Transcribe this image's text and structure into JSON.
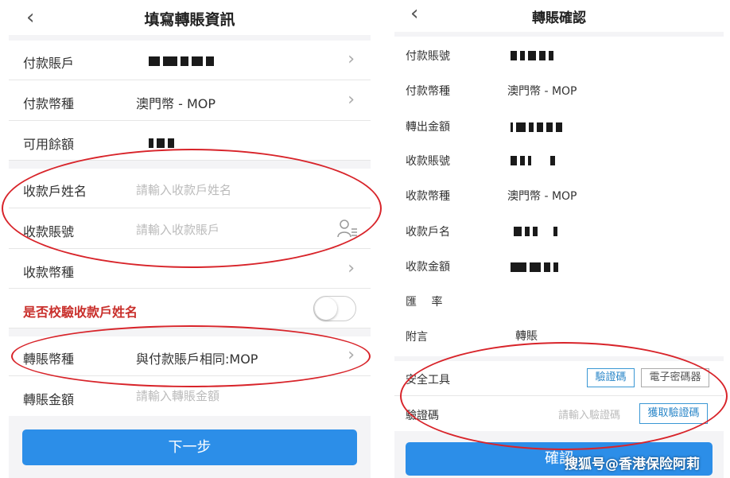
{
  "left": {
    "back_icon": "‹",
    "title": "填寫轉賬資訊",
    "rows": {
      "pay_account": {
        "label": "付款賬戶"
      },
      "pay_currency": {
        "label": "付款幣種",
        "value": "澳門幣 - MOP"
      },
      "available": {
        "label": "可用餘額"
      },
      "payee_name": {
        "label": "收款戶姓名",
        "placeholder": "請輸入收款戶姓名"
      },
      "payee_account": {
        "label": "收款賬號",
        "placeholder": "請輸入收款賬戶"
      },
      "payee_currency": {
        "label": "收款幣種"
      },
      "verify_name": {
        "label": "是否校驗收款戶姓名"
      },
      "transfer_currency": {
        "label": "轉賬幣種",
        "value": "與付款賬戶相同:MOP"
      },
      "transfer_amount": {
        "label": "轉賬金額",
        "placeholder": "請輸入轉賬金額"
      }
    },
    "next_button": "下一步"
  },
  "right": {
    "back_icon": "‹",
    "title": "轉賬確認",
    "rows": {
      "pay_account_no": {
        "label": "付款賬號"
      },
      "pay_currency": {
        "label": "付款幣種",
        "value": "澳門幣 - MOP"
      },
      "out_amount": {
        "label": "轉出金額"
      },
      "payee_account_no": {
        "label": "收款賬號"
      },
      "payee_currency": {
        "label": "收款幣種",
        "value": "澳門幣 - MOP"
      },
      "payee_name": {
        "label": "收款戶名"
      },
      "receive_amount": {
        "label": "收款金額"
      },
      "rate": {
        "label": "匯　 率"
      },
      "note": {
        "label": "附言",
        "value": "轉賬"
      },
      "security_tool": {
        "label": "安全工具",
        "btn_code": "驗證碼",
        "btn_token": "電子密碼器"
      },
      "code": {
        "label": "驗證碼",
        "placeholder": "請輸入驗證碼",
        "btn_get": "獲取驗證碼"
      }
    },
    "confirm_button": "確認"
  },
  "watermark": "搜狐号@香港保险阿莉",
  "colors": {
    "accent": "#2c8ee8",
    "annotation": "#d8242a",
    "warning_label": "#c9302c"
  }
}
